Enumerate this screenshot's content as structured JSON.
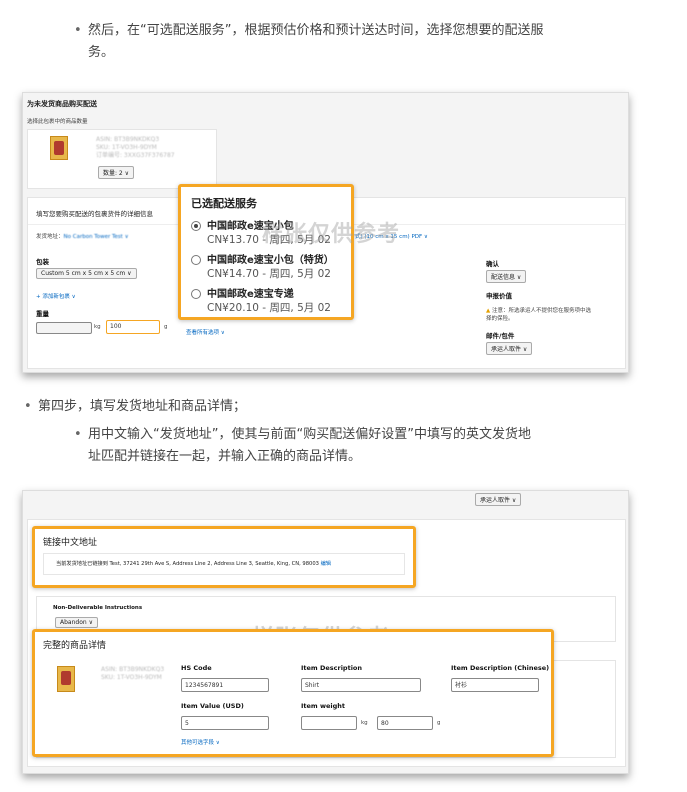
{
  "step_intro": {
    "text": "然后，在“可选配送服务”，根据预估价格和预计送达时间，选择您想要的配送服务。",
    "line1": "然后，在“可选配送服务”，根据预估价格和预计送达时间，选择您想要的配送服",
    "line2": "务。"
  },
  "shot1": {
    "title": "为未发货商品购买配送",
    "subtitle": "选择此包裹中的商品数量",
    "qty_btn": "数量: 2 ∨",
    "section_title": "填写您要购买配送的包裹货件的详细信息",
    "ship_from_label": "发货地址：",
    "ship_method": "寄方式) (10 cm x 15 cm) PDF ∨",
    "package_label": "包装",
    "package_value": "Custom 5 cm x 5 cm x 5 cm ∨",
    "add_package": "+ 添加新包裹 ∨",
    "weight_label": "重量",
    "weight_unit": "kg",
    "weight_value": "100",
    "weight_unit2": "g",
    "view_all": "查看所有选项 ∨",
    "confirm_label": "确认",
    "confirm_btn": "配送信息 ∨",
    "declare_label": "申报价值",
    "warning": "注意：所选承运人不提供您在服务项中选择的保险。",
    "shipper_label": "邮件/包件",
    "shipper_btn": "承运人取件 ∨",
    "popup": {
      "title": "已选配送服务",
      "options": [
        {
          "name": "中国邮政e速宝小包",
          "price": "CN¥13.70 - 周四, 5月 02",
          "selected": true
        },
        {
          "name": "中国邮政e速宝小包（特货）",
          "price": "CN¥14.70 - 周四, 5月 02",
          "selected": false
        },
        {
          "name": "中国邮政e速宝专递",
          "price": "CN¥20.10 - 周四, 5月 02",
          "selected": false
        }
      ]
    },
    "watermark": "样张仅供参考"
  },
  "step4": {
    "text": "第四步，填写发货地址和商品详情；",
    "sub_line1": "用中文输入“发货地址”，使其与前面“购买配送偏好设置”中填写的英文发货地",
    "sub_line2": "址匹配并链接在一起，并输入正确的商品详情。"
  },
  "shot2": {
    "top_btn": "承运人取件 ∨",
    "link_title": "链接中文地址",
    "link_text": "当前发货地址已链接到 Test, 37241 29th Ave S, Address Line 2, Address Line 3, Seattle, King, CN, 98003",
    "link_edit": "编辑",
    "non_deliverable_label": "Non-Deliverable Instructions",
    "non_deliverable_value": "Abandon ∨",
    "watermark": "样张仅供参考",
    "detail_title": "完整的商品详情",
    "hs_code_label": "HS Code",
    "hs_code_value": "1234567891",
    "item_desc_label": "Item Description",
    "item_desc_value": "Shirt",
    "item_desc_cn_label": "Item Description (Chinese)",
    "item_desc_cn_value": "衬衫",
    "item_value_label": "Item Value (USD)",
    "item_value_value": "5",
    "item_weight_label": "Item weight",
    "weight_unit": "kg",
    "weight_value": "80",
    "weight_unit2": "g",
    "more_fields": "其他可选字段 ∨"
  }
}
